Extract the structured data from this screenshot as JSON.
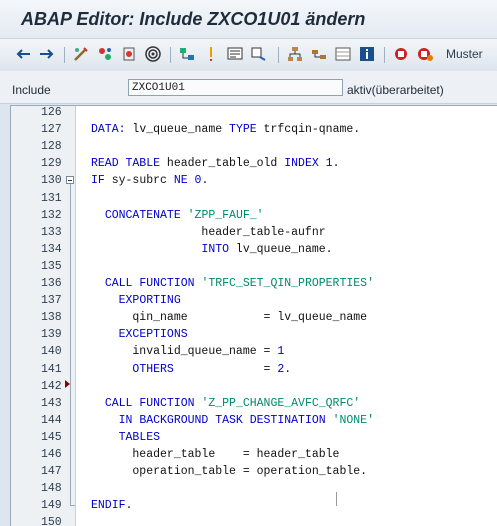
{
  "window": {
    "title": "ABAP Editor: Include ZXCO1U01 ändern"
  },
  "toolbar": {
    "buttons": [
      {
        "name": "back-arrow-icon"
      },
      {
        "name": "forward-arrow-icon"
      },
      {
        "name": "display-change-icon"
      },
      {
        "name": "other-object-icon"
      },
      {
        "name": "activate-icon"
      },
      {
        "name": "test-icon"
      },
      {
        "name": "where-used-icon"
      },
      {
        "name": "mark-icon"
      },
      {
        "name": "display-object-list-icon"
      },
      {
        "name": "navigation-window-icon"
      },
      {
        "name": "hierarchy-icon"
      },
      {
        "name": "enhance-icon"
      },
      {
        "name": "pattern-list-icon"
      },
      {
        "name": "info-icon"
      },
      {
        "name": "breakpoint-icon"
      },
      {
        "name": "session-breakpoint-icon"
      }
    ],
    "muster_label": "Muster"
  },
  "include_bar": {
    "label": "Include",
    "value": "ZXCO1U01",
    "status": "aktiv(überarbeitet)"
  },
  "editor": {
    "line_numbers": [
      "126",
      "127",
      "128",
      "129",
      "130",
      "131",
      "132",
      "133",
      "134",
      "135",
      "136",
      "137",
      "138",
      "139",
      "140",
      "141",
      "142",
      "143",
      "144",
      "145",
      "146",
      "147",
      "148",
      "149",
      "150"
    ],
    "lines": [
      [],
      [
        {
          "t": "DATA:",
          "c": "kw"
        },
        {
          "t": " lv_queue_name "
        },
        {
          "t": "TYPE",
          "c": "kw"
        },
        {
          "t": " trfcqin-qname."
        }
      ],
      [],
      [
        {
          "t": "READ TABLE",
          "c": "kw"
        },
        {
          "t": " header_table_old "
        },
        {
          "t": "INDEX",
          "c": "kw"
        },
        {
          "t": " "
        },
        {
          "t": "1",
          "c": "num"
        },
        {
          "t": "."
        }
      ],
      [
        {
          "t": "IF",
          "c": "kw"
        },
        {
          "t": " sy-subrc "
        },
        {
          "t": "NE",
          "c": "kw"
        },
        {
          "t": " "
        },
        {
          "t": "0",
          "c": "num"
        },
        {
          "t": "."
        }
      ],
      [],
      [
        {
          "t": "  "
        },
        {
          "t": "CONCATENATE",
          "c": "kw"
        },
        {
          "t": " "
        },
        {
          "t": "'ZPP_FAUF_'",
          "c": "str"
        }
      ],
      [
        {
          "t": "                header_table-aufnr"
        }
      ],
      [
        {
          "t": "                "
        },
        {
          "t": "INTO",
          "c": "kw"
        },
        {
          "t": " lv_queue_name."
        }
      ],
      [],
      [
        {
          "t": "  "
        },
        {
          "t": "CALL FUNCTION",
          "c": "kw"
        },
        {
          "t": " "
        },
        {
          "t": "'TRFC_SET_QIN_PROPERTIES'",
          "c": "str"
        }
      ],
      [
        {
          "t": "    "
        },
        {
          "t": "EXPORTING",
          "c": "kw"
        }
      ],
      [
        {
          "t": "      qin_name           = lv_queue_name"
        }
      ],
      [
        {
          "t": "    "
        },
        {
          "t": "EXCEPTIONS",
          "c": "kw"
        }
      ],
      [
        {
          "t": "      invalid_queue_name = "
        },
        {
          "t": "1",
          "c": "num"
        }
      ],
      [
        {
          "t": "      "
        },
        {
          "t": "OTHERS",
          "c": "kw"
        },
        {
          "t": "             = "
        },
        {
          "t": "2",
          "c": "num"
        },
        {
          "t": "."
        }
      ],
      [],
      [
        {
          "t": "  "
        },
        {
          "t": "CALL FUNCTION",
          "c": "kw"
        },
        {
          "t": " "
        },
        {
          "t": "'Z_PP_CHANGE_AVFC_QRFC'",
          "c": "str"
        }
      ],
      [
        {
          "t": "    "
        },
        {
          "t": "IN BACKGROUND TASK DESTINATION",
          "c": "kw"
        },
        {
          "t": " "
        },
        {
          "t": "'NONE'",
          "c": "str"
        }
      ],
      [
        {
          "t": "    "
        },
        {
          "t": "TABLES",
          "c": "kw"
        }
      ],
      [
        {
          "t": "      header_table    = header_table"
        }
      ],
      [
        {
          "t": "      operation_table = operation_table."
        }
      ],
      [],
      [
        {
          "t": "ENDIF",
          "c": "kw"
        },
        {
          "t": "."
        }
      ],
      []
    ]
  },
  "colors": {
    "keyword": "#0000cc",
    "string": "#008a6e",
    "breakpoint": "#8b0000"
  }
}
